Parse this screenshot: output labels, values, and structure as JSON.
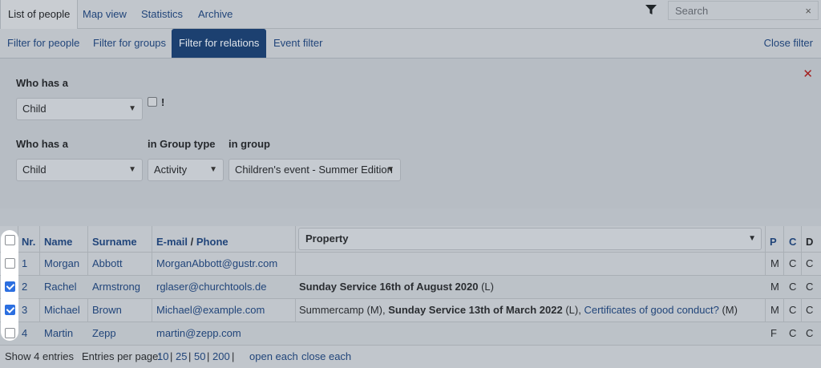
{
  "top_tabs": [
    {
      "label": "List of people",
      "active": true
    },
    {
      "label": "Map view"
    },
    {
      "label": "Statistics"
    },
    {
      "label": "Archive"
    }
  ],
  "search": {
    "placeholder": "Search",
    "clear": "×"
  },
  "filter_tabs": [
    {
      "label": "Filter for people"
    },
    {
      "label": "Filter for groups"
    },
    {
      "label": "Filter for relations",
      "active": true
    },
    {
      "label": "Event filter"
    }
  ],
  "close_filter": "Close filter",
  "panel": {
    "close": "✕",
    "row1": {
      "who_label": "Who has a",
      "who_value": "Child",
      "negate": "!"
    },
    "row2": {
      "who_label": "Who has a",
      "who_value": "Child",
      "group_type_label": "in Group type",
      "group_type_value": "Activity",
      "group_label": "in group",
      "group_value": "Children's event - Summer Edition"
    }
  },
  "table": {
    "headers": {
      "nr": "Nr.",
      "name": "Name",
      "surname": "Surname",
      "email": "E-mail",
      "slash": "/",
      "phone": "Phone",
      "property": "Property",
      "p": "P",
      "c": "C",
      "d": "D"
    },
    "rows": [
      {
        "nr": "1",
        "name": "Morgan",
        "surname": "Abbott",
        "email": "MorganAbbott@gustr.com",
        "p": "M",
        "c": "C",
        "d": "C",
        "checked": false
      },
      {
        "nr": "2",
        "name": "Rachel",
        "surname": "Armstrong",
        "email": "rglaser@churchtools.de",
        "prop_bold": "Sunday Service 16th of August 2020",
        "prop_tail": " (L)",
        "p": "M",
        "c": "C",
        "d": "C",
        "checked": true
      },
      {
        "nr": "3",
        "name": "Michael",
        "surname": "Brown",
        "email": "Michael@example.com",
        "prop_pre": "Summercamp (M), ",
        "prop_bold": "Sunday Service 13th of March 2022",
        "prop_mid": " (L), ",
        "prop_link": "Certificates of good conduct?",
        "prop_tail": " (M)",
        "p": "M",
        "c": "C",
        "d": "C",
        "checked": true
      },
      {
        "nr": "4",
        "name": "Martin",
        "surname": "Zepp",
        "email": "martin@zepp.com",
        "p": "F",
        "c": "C",
        "d": "C",
        "checked": false
      }
    ]
  },
  "footer": {
    "count": "Show 4 entries",
    "per_page_label": "Entries per page:",
    "per_page": [
      "10",
      "25",
      "50",
      "200"
    ],
    "sep": "|",
    "open_each": "open each",
    "close_each": "close each"
  },
  "colors": {
    "accent": "#1c4070",
    "link": "#21457a",
    "close_red": "#a32020",
    "checkbox_blue": "#2c6fe0"
  },
  "icons": [
    "filter-icon",
    "close-icon",
    "chevron-down-icon"
  ]
}
